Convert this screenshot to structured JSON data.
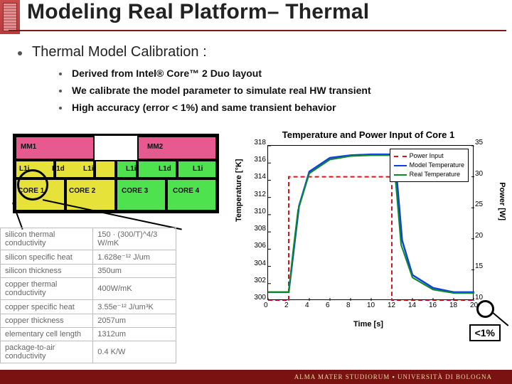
{
  "title": "Modeling Real Platform– Thermal",
  "bullets": {
    "l1": "Thermal Model Calibration :",
    "s1": "Derived from Intel® Core™ 2 Duo layout",
    "s2": "We calibrate the model parameter to simulate real HW transient",
    "s3": "High accuracy (error < 1%) and same transient behavior"
  },
  "die": {
    "mm1": "MM1",
    "mm2": "MM2",
    "l1a": "L1i",
    "l1b": "L1d",
    "l1c": "L1i",
    "l1d": "L1i",
    "l1e": "L1d",
    "l1f": "L1i",
    "c1": "CORE 1",
    "c2": "CORE 2",
    "c3": "CORE 3",
    "c4": "CORE 4"
  },
  "params": [
    [
      "silicon thermal conductivity",
      "150 · (300/T)^4/3 W/mK"
    ],
    [
      "silicon specific heat",
      "1.628e⁻¹² J/um"
    ],
    [
      "silicon thickness",
      "350um"
    ],
    [
      "copper thermal conductivity",
      "400W/mK"
    ],
    [
      "copper specific heat",
      "3.55e⁻¹² J/um³K"
    ],
    [
      "copper thickness",
      "2057um"
    ],
    [
      "elementary cell length",
      "1312um"
    ],
    [
      "package-to-air conductivity",
      "0.4 K/W"
    ]
  ],
  "chart_data": {
    "type": "line",
    "title": "Temperature and Power Input of Core 1",
    "xlabel": "Time [s]",
    "ylabel": "Temperature [°K]",
    "y2label": "Power [W]",
    "xlim": [
      0,
      20
    ],
    "ylim": [
      300,
      318
    ],
    "y2lim": [
      10,
      35
    ],
    "xticks": [
      0,
      2,
      4,
      6,
      8,
      10,
      12,
      14,
      16,
      18,
      20
    ],
    "yticks": [
      300,
      302,
      304,
      306,
      308,
      310,
      312,
      314,
      316,
      318
    ],
    "y2ticks": [
      10,
      15,
      20,
      25,
      30,
      35
    ],
    "series": [
      {
        "name": "Power Input",
        "axis": "y2",
        "style": "dashed-red",
        "x": [
          0,
          2,
          2,
          12,
          12,
          20
        ],
        "y": [
          10,
          10,
          30,
          30,
          10,
          10
        ]
      },
      {
        "name": "Model Temperature",
        "axis": "y",
        "style": "blue",
        "x": [
          0,
          2,
          2.5,
          3,
          4,
          6,
          8,
          10,
          12,
          12.5,
          13,
          14,
          16,
          18,
          20
        ],
        "y": [
          301,
          301,
          306,
          311,
          315,
          316.6,
          316.9,
          317,
          317,
          314,
          307,
          303,
          301.5,
          301,
          301
        ]
      },
      {
        "name": "Real Temperature",
        "axis": "y",
        "style": "green",
        "x": [
          0,
          2,
          2.4,
          2.9,
          4,
          6,
          8,
          10,
          12,
          12.4,
          12.9,
          14,
          16,
          18,
          20
        ],
        "y": [
          301,
          301,
          305.5,
          310.5,
          314.8,
          316.4,
          316.8,
          316.9,
          316.9,
          313.5,
          306.5,
          302.7,
          301.3,
          300.9,
          300.9
        ]
      }
    ],
    "legend": [
      "Power Input",
      "Model Temperature",
      "Real Temperature"
    ]
  },
  "annotation": {
    "err": "<1%"
  },
  "footer": "ALMA MATER STUDIORUM ▪ UNIVERSITÀ DI BOLOGNA"
}
